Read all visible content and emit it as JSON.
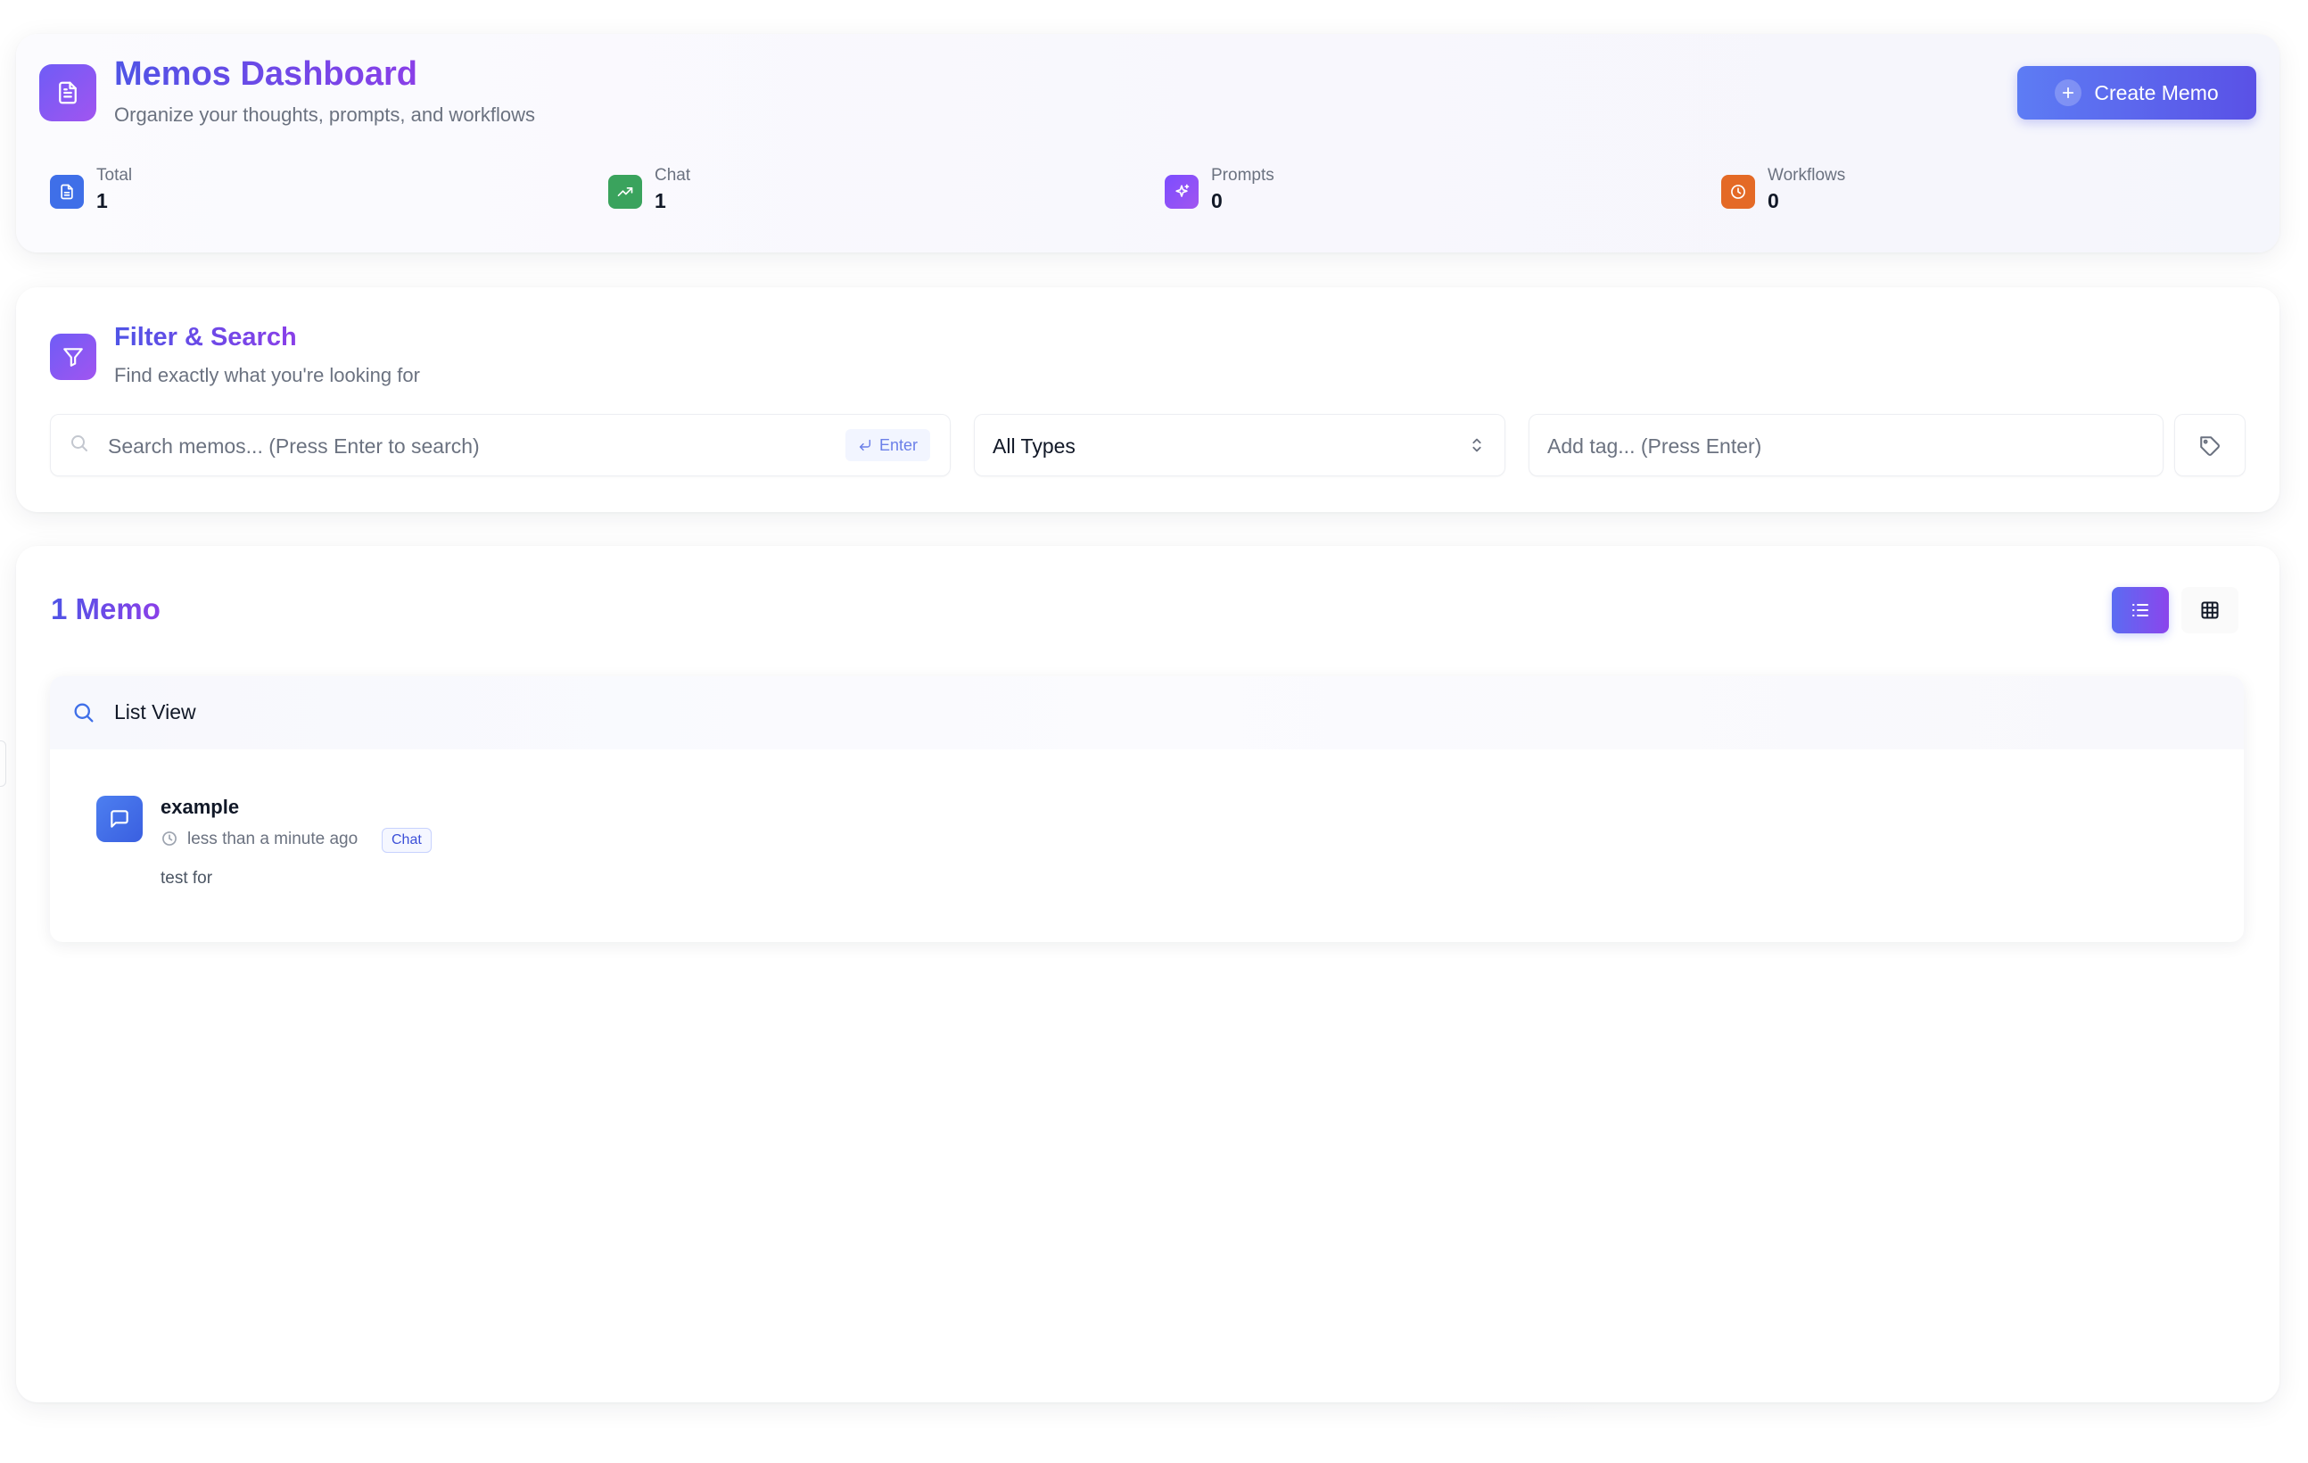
{
  "header": {
    "title": "Memos Dashboard",
    "subtitle": "Organize your thoughts, prompts, and workflows",
    "icon": "document-icon",
    "create_button_label": "Create Memo",
    "stats": [
      {
        "label": "Total",
        "value": "1",
        "icon": "document-icon",
        "color": "#3f6fe8"
      },
      {
        "label": "Chat",
        "value": "1",
        "icon": "trending-up-icon",
        "color": "#3aa35d"
      },
      {
        "label": "Prompts",
        "value": "0",
        "icon": "sparkles-icon",
        "color": "#8b45ec"
      },
      {
        "label": "Workflows",
        "value": "0",
        "icon": "clock-icon",
        "color": "#e46a26"
      }
    ]
  },
  "filter": {
    "title": "Filter & Search",
    "subtitle": "Find exactly what you're looking for",
    "search_placeholder": "Search memos... (Press Enter to search)",
    "enter_badge": "Enter",
    "type_select_value": "All Types",
    "tag_placeholder": "Add tag... (Press Enter)"
  },
  "memos": {
    "count_label": "1 Memo",
    "panel_title": "List View",
    "items": [
      {
        "title": "example",
        "time": "less than a minute ago",
        "type_badge": "Chat",
        "content": "test for"
      }
    ]
  },
  "colors": {
    "accent_start": "#4f54e6",
    "accent_end": "#8a3fe8",
    "chat_blue": "#3f6fe8"
  }
}
